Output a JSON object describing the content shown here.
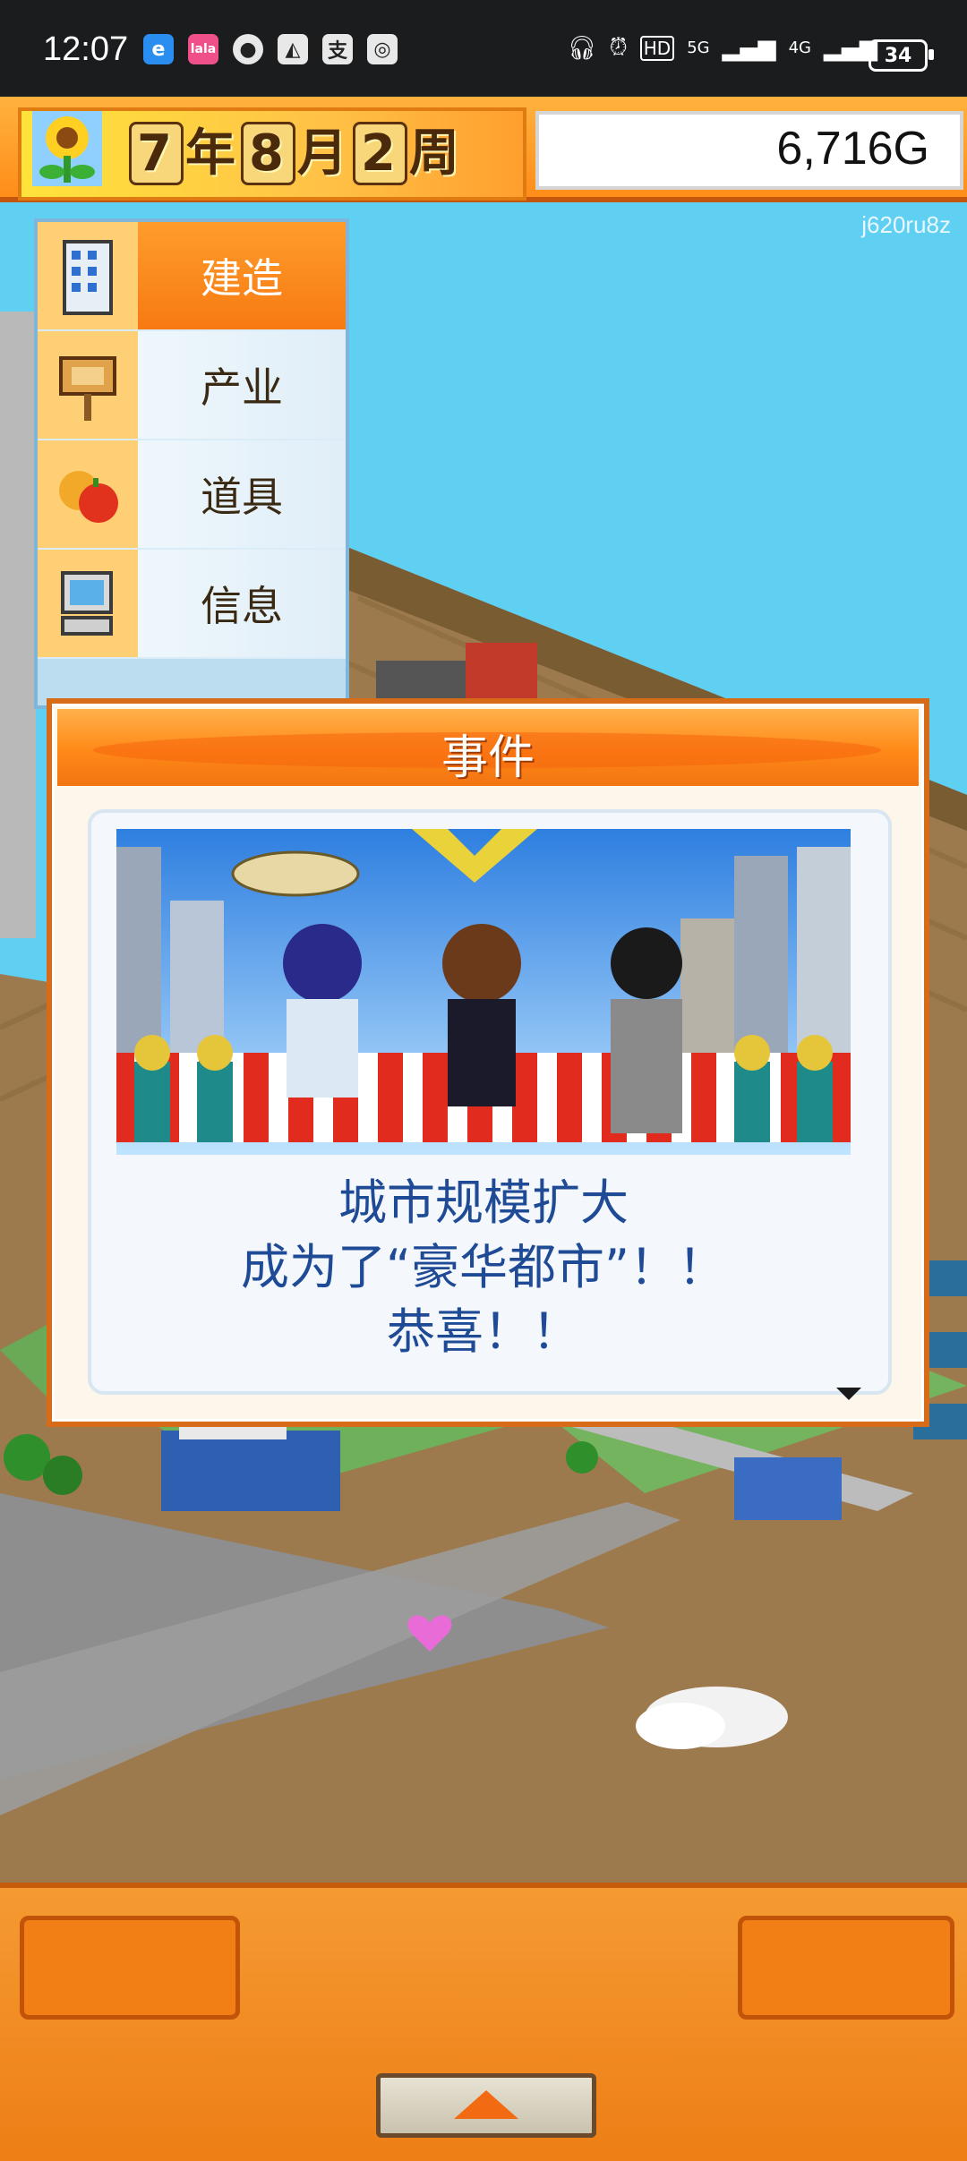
{
  "status_bar": {
    "time": "12:07",
    "left_icons": [
      "app-icon-1",
      "app-icon-2",
      "chat-icon",
      "app-icon-3",
      "alipay-icon",
      "app-icon-4"
    ],
    "network": "5G",
    "network2": "4G",
    "hd_label": "HD",
    "battery": "34"
  },
  "header": {
    "date_year": "7",
    "date_year_unit": "年",
    "date_month": "8",
    "date_month_unit": "月",
    "date_week": "2",
    "date_week_unit": "周",
    "money": "6,716G"
  },
  "watermark": "j620ru8z",
  "menu": {
    "items": [
      {
        "label": "建造",
        "icon": "building-icon",
        "active": true
      },
      {
        "label": "产业",
        "icon": "signboard-icon",
        "active": false
      },
      {
        "label": "道具",
        "icon": "fruit-icon",
        "active": false
      },
      {
        "label": "信息",
        "icon": "computer-icon",
        "active": false
      }
    ]
  },
  "dialog": {
    "title": "事件",
    "message_lines": [
      "城市规模扩大",
      "成为了“豪华都市”！！",
      "恭喜！！"
    ]
  },
  "bottom": {
    "expand_icon": "triangle-up-icon"
  },
  "colors": {
    "orange": "#f27a14",
    "sky": "#5fd0f2",
    "message_blue": "#1e4a96"
  }
}
